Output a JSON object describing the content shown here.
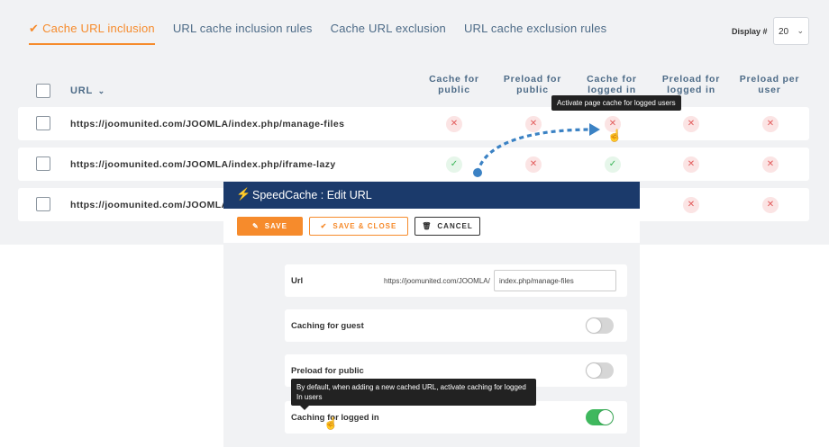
{
  "tabs": [
    {
      "label": "Cache URL inclusion",
      "active": true
    },
    {
      "label": "URL cache inclusion rules"
    },
    {
      "label": "Cache URL exclusion"
    },
    {
      "label": "URL cache exclusion rules"
    }
  ],
  "display": {
    "label": "Display #",
    "value": "20"
  },
  "table": {
    "url_header": "URL",
    "columns": [
      [
        "Cache for",
        "public"
      ],
      [
        "Preload for",
        "public"
      ],
      [
        "Cache for",
        "logged in"
      ],
      [
        "Preload for",
        "logged in"
      ],
      [
        "Preload per",
        "user"
      ]
    ],
    "rows": [
      {
        "url": "https://joomunited.com/JOOMLA/index.php/manage-files",
        "status": [
          "off",
          "off",
          "off",
          "off",
          "off"
        ]
      },
      {
        "url": "https://joomunited.com/JOOMLA/index.php/iframe-lazy",
        "status": [
          "on",
          "off",
          "on",
          "off",
          "off"
        ]
      },
      {
        "url": "https://joomunited.com/JOOMLA",
        "status": [
          "off",
          "off",
          "off",
          "off",
          "off"
        ]
      }
    ]
  },
  "tooltip_top": "Activate page cache for logged users",
  "modal": {
    "title": "SpeedCache : Edit URL",
    "save": "SAVE",
    "save_close": "SAVE & CLOSE",
    "cancel": "CANCEL",
    "url_label": "Url",
    "url_prefix": "https://joomunited.com/JOOMLA/",
    "url_value": "index.php/manage-files",
    "caching_guest": "Caching for guest",
    "preload_public": "Preload for public",
    "caching_logged": "Caching for logged in",
    "toggles": {
      "caching_guest": false,
      "preload_public": false,
      "caching_logged": true
    },
    "tooltip_bottom": "By default, when adding a new cached URL, activate caching for logged In users"
  },
  "colors": {
    "accent": "#f68b2c",
    "modal_bar": "#1b3a6b",
    "toggle_on": "#3fb85e",
    "status_off": "#e25b5b",
    "status_on": "#37b455"
  },
  "icons": {
    "active_tab": "check-icon",
    "sort": "chevron-down-icon",
    "modal_logo": "bolt-icon",
    "status_off": "x-icon",
    "status_on": "check-icon",
    "cursor": "pointer-hand-icon"
  }
}
